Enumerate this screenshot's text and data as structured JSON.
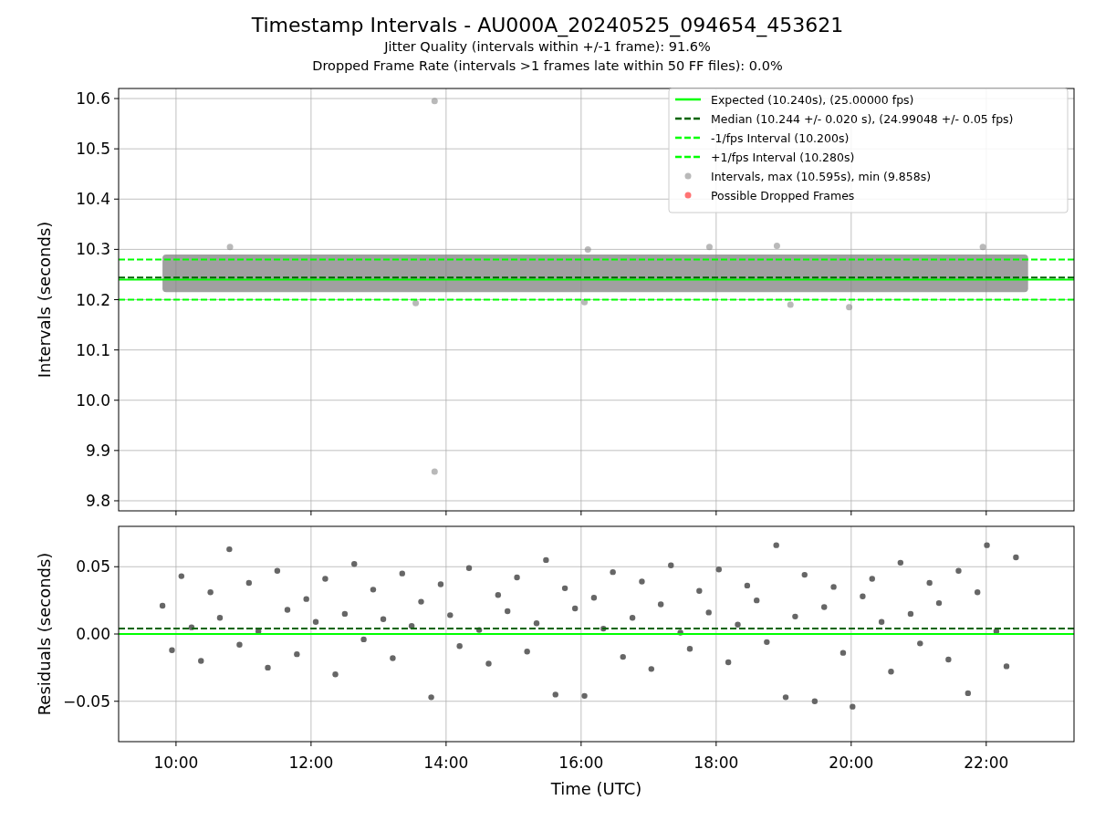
{
  "figure": {
    "title": "Timestamp Intervals - AU000A_20240525_094654_453621",
    "subtitles": [
      "Jitter Quality (intervals within +/-1 frame): 91.6%",
      "Dropped Frame Rate (intervals >1 frames late within 50 FF files): 0.0%"
    ]
  },
  "intervals_panel": {
    "chart_data": {
      "type": "scatter",
      "ylabel": "Intervals (seconds)",
      "xlim": [
        9.15,
        23.3
      ],
      "ylim": [
        9.78,
        10.62
      ],
      "grid": true,
      "yticks": [
        {
          "value": 9.8,
          "label": "9.8"
        },
        {
          "value": 9.9,
          "label": "9.9"
        },
        {
          "value": 10.0,
          "label": "10.0"
        },
        {
          "value": 10.1,
          "label": "10.1"
        },
        {
          "value": 10.2,
          "label": "10.2"
        },
        {
          "value": 10.3,
          "label": "10.3"
        },
        {
          "value": 10.4,
          "label": "10.4"
        },
        {
          "value": 10.5,
          "label": "10.5"
        },
        {
          "value": 10.6,
          "label": "10.6"
        }
      ],
      "legend": true,
      "bands": [
        {
          "axis": "y",
          "from": 10.215,
          "to": 10.29,
          "color": "#808080"
        }
      ],
      "series": [
        {
          "name": "Expected (10.240s), (25.00000 fps)",
          "type": "line",
          "line_style": "solid",
          "color": "#00ff00",
          "x": [
            9.15,
            23.3
          ],
          "values": [
            10.24,
            10.24
          ]
        },
        {
          "name": "Median (10.244 +/- 0.020 s), (24.99048 +/- 0.05 fps)",
          "type": "line",
          "line_style": "dashed",
          "color": "#006400",
          "x": [
            9.15,
            23.3
          ],
          "values": [
            10.244,
            10.244
          ]
        },
        {
          "name": "-1/fps Interval (10.200s)",
          "type": "line",
          "line_style": "dashed",
          "color": "#00ff00",
          "x": [
            9.15,
            23.3
          ],
          "values": [
            10.2,
            10.2
          ]
        },
        {
          "name": "+1/fps Interval (10.280s)",
          "type": "line",
          "line_style": "dashed",
          "color": "#00ff00",
          "x": [
            9.15,
            23.3
          ],
          "values": [
            10.28,
            10.28
          ]
        },
        {
          "name": "Intervals, max (10.595s), min (9.858s)",
          "color": "#808080",
          "x": [
            13.83,
            13.83,
            10.8,
            16.1,
            17.9,
            18.9,
            21.95,
            13.55,
            16.05,
            19.1,
            19.97
          ],
          "values": [
            10.595,
            9.858,
            10.305,
            10.3,
            10.305,
            10.307,
            10.305,
            10.193,
            10.195,
            10.19,
            10.185
          ]
        },
        {
          "name": "Possible Dropped Frames",
          "color": "#ff0000"
        }
      ]
    }
  },
  "residuals_panel": {
    "chart_data": {
      "type": "scatter",
      "ylabel": "Residuals (seconds)",
      "xlabel": "Time (UTC)",
      "xlim": [
        9.15,
        23.3
      ],
      "ylim": [
        -0.08,
        0.08
      ],
      "grid": true,
      "xticks": [
        {
          "value": 10,
          "label": "10:00"
        },
        {
          "value": 12,
          "label": "12:00"
        },
        {
          "value": 14,
          "label": "14:00"
        },
        {
          "value": 16,
          "label": "16:00"
        },
        {
          "value": 18,
          "label": "18:00"
        },
        {
          "value": 20,
          "label": "20:00"
        },
        {
          "value": 22,
          "label": "22:00"
        }
      ],
      "yticks": [
        {
          "value": -0.05,
          "label": "−0.05"
        },
        {
          "value": 0,
          "label": "0.00"
        },
        {
          "value": 0.05,
          "label": "0.05"
        }
      ],
      "series": [
        {
          "color": "#666666",
          "x": [
            9.8,
            9.94,
            10.08,
            10.23,
            10.37,
            10.51,
            10.65,
            10.79,
            10.94,
            11.08,
            11.22,
            11.36,
            11.5,
            11.65,
            11.79,
            11.93,
            12.07,
            12.21,
            12.36,
            12.5,
            12.64,
            12.78,
            12.92,
            13.07,
            13.21,
            13.35,
            13.49,
            13.63,
            13.78,
            13.92,
            14.06,
            14.2,
            14.34,
            14.49,
            14.63,
            14.77,
            14.91,
            15.05,
            15.2,
            15.34,
            15.48,
            15.62,
            15.76,
            15.91,
            16.05,
            16.19,
            16.33,
            16.47,
            16.62,
            16.76,
            16.9,
            17.04,
            17.18,
            17.33,
            17.47,
            17.61,
            17.75,
            17.89,
            18.04,
            18.18,
            18.32,
            18.46,
            18.6,
            18.75,
            18.89,
            19.03,
            19.17,
            19.31,
            19.46,
            19.6,
            19.74,
            19.88,
            20.02,
            20.17,
            20.31,
            20.45,
            20.59,
            20.73,
            20.88,
            21.02,
            21.16,
            21.3,
            21.44,
            21.59,
            21.73,
            21.87,
            22.01,
            22.15,
            22.3,
            22.44
          ],
          "values": [
            0.021,
            -0.012,
            0.043,
            0.005,
            -0.02,
            0.031,
            0.012,
            0.063,
            -0.008,
            0.038,
            0.002,
            -0.025,
            0.047,
            0.018,
            -0.015,
            0.026,
            0.009,
            0.041,
            -0.03,
            0.015,
            0.052,
            -0.004,
            0.033,
            0.011,
            -0.018,
            0.045,
            0.006,
            0.024,
            -0.047,
            0.037,
            0.014,
            -0.009,
            0.049,
            0.003,
            -0.022,
            0.029,
            0.017,
            0.042,
            -0.013,
            0.008,
            0.055,
            -0.045,
            0.034,
            0.019,
            -0.046,
            0.027,
            0.004,
            0.046,
            -0.017,
            0.012,
            0.039,
            -0.026,
            0.022,
            0.051,
            0.001,
            -0.011,
            0.032,
            0.016,
            0.048,
            -0.021,
            0.007,
            0.036,
            0.025,
            -0.006,
            0.066,
            -0.047,
            0.013,
            0.044,
            -0.05,
            0.02,
            0.035,
            -0.014,
            -0.054,
            0.028,
            0.041,
            0.009,
            -0.028,
            0.053,
            0.015,
            -0.007,
            0.038,
            0.023,
            -0.019,
            0.047,
            -0.044,
            0.031,
            0.066,
            0.002,
            -0.024,
            0.057
          ]
        },
        {
          "type": "line",
          "line_style": "solid",
          "color": "#00ff00",
          "x": [
            9.15,
            23.3
          ],
          "values": [
            0,
            0
          ]
        },
        {
          "type": "line",
          "line_style": "dashed",
          "color": "#006400",
          "x": [
            9.15,
            23.3
          ],
          "values": [
            0.004,
            0.004
          ]
        }
      ]
    }
  }
}
